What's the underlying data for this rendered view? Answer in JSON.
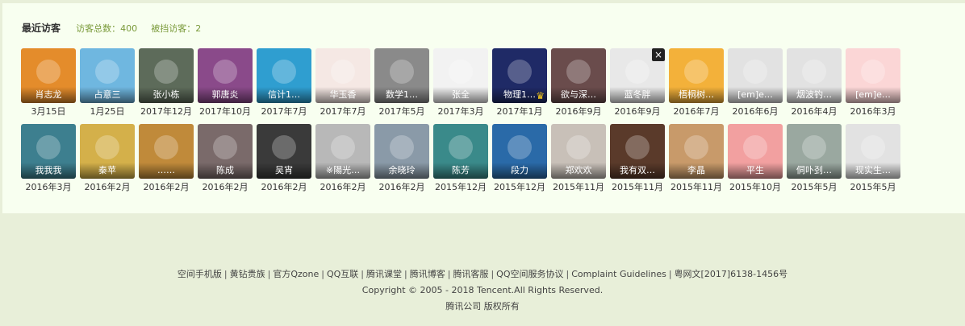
{
  "header": {
    "title": "最近访客",
    "total_visitors": "访客总数：400",
    "blocked_visitors": "被挡访客：2"
  },
  "visitors": [
    {
      "name": "肖志龙",
      "date": "3月15日",
      "color": "#e48c2b"
    },
    {
      "name": "占意三",
      "date": "1月25日",
      "color": "#6fb7e0"
    },
    {
      "name": "张小栋",
      "date": "2017年12月",
      "color": "#5d6b5a"
    },
    {
      "name": "郭唐炎",
      "date": "2017年10月",
      "color": "#8a4a8a"
    },
    {
      "name": "信计1…",
      "date": "2017年7月",
      "color": "#2f9ed0"
    },
    {
      "name": "华玉香",
      "date": "2017年7月",
      "color": "#f5e8e4"
    },
    {
      "name": "数学1…",
      "date": "2017年5月",
      "color": "#8a8a8a"
    },
    {
      "name": "张全",
      "date": "2017年3月",
      "color": "#f2f2f2"
    },
    {
      "name": "物理1…",
      "date": "2017年1月",
      "color": "#1f2a66",
      "crown": true
    },
    {
      "name": "欲与深…",
      "date": "2016年9月",
      "color": "#6a4c4c"
    },
    {
      "name": "蓝冬胖",
      "date": "2016年9月",
      "color": "#e8e8e8",
      "close": true
    },
    {
      "name": "梧桐树…",
      "date": "2016年7月",
      "color": "#f3b13a"
    },
    {
      "name": "[em]e…",
      "date": "2016年6月",
      "color": "#e2e2e2"
    },
    {
      "name": "烟波钓…",
      "date": "2016年4月",
      "color": "#e2e2e2"
    },
    {
      "name": "[em]e…",
      "date": "2016年3月",
      "color": "#fbd6d6"
    },
    {
      "name": "我我我",
      "date": "2016年3月",
      "color": "#3d7f8f"
    },
    {
      "name": "秦苹",
      "date": "2016年2月",
      "color": "#d4b04a"
    },
    {
      "name": "……",
      "date": "2016年2月",
      "color": "#c08a3a"
    },
    {
      "name": "陈成",
      "date": "2016年2月",
      "color": "#7a6a6a"
    },
    {
      "name": "吴宵",
      "date": "2016年2月",
      "color": "#3a3a3a"
    },
    {
      "name": "※陽光…",
      "date": "2016年2月",
      "color": "#b8b8b8"
    },
    {
      "name": "余晓玲",
      "date": "2016年2月",
      "color": "#8a9aa8"
    },
    {
      "name": "陈芳",
      "date": "2015年12月",
      "color": "#3a8a8a"
    },
    {
      "name": "段力",
      "date": "2015年12月",
      "color": "#2a6aa8"
    },
    {
      "name": "郑欢欢",
      "date": "2015年11月",
      "color": "#c8c0b8"
    },
    {
      "name": "我有双…",
      "date": "2015年11月",
      "color": "#5a3a2a"
    },
    {
      "name": "李晶",
      "date": "2015年11月",
      "color": "#c89a6a"
    },
    {
      "name": "平生",
      "date": "2015年10月",
      "color": "#f2a0a0"
    },
    {
      "name": "侗卟刭…",
      "date": "2015年5月",
      "color": "#9aa8a0"
    },
    {
      "name": "现实生…",
      "date": "2015年5月",
      "color": "#e2e2e2"
    }
  ],
  "icons": {
    "close": "×",
    "crown": "♛"
  },
  "footer": {
    "links": [
      "空间手机版",
      "黄钻贵族",
      "官方Qzone",
      "QQ互联",
      "腾讯课堂",
      "腾讯博客",
      "腾讯客服",
      "QQ空间服务协议",
      "Complaint Guidelines",
      "粤网文[2017]6138-1456号"
    ],
    "separator": "|",
    "copyright": "Copyright © 2005 - 2018 Tencent.All Rights Reserved.",
    "owner": "腾讯公司 版权所有"
  }
}
